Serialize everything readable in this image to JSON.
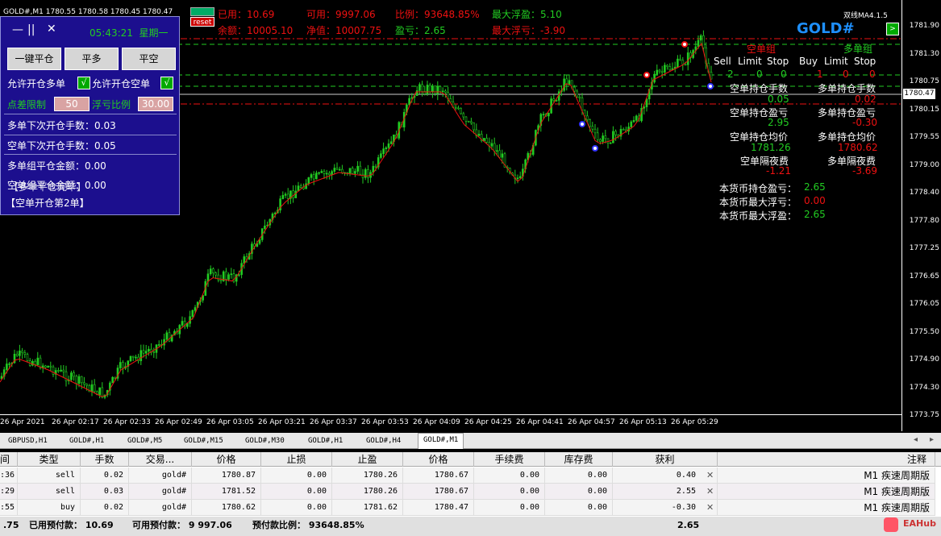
{
  "chart": {
    "title": "GOLD#,M1  1780.55 1780.58 1780.45 1780.47",
    "symbol_big": "GOLD#",
    "ma_label": "双线MA4.1.5",
    "reset_label": "reset",
    "current_price": "1780.47",
    "price_ticks": [
      "1781.90",
      "1781.30",
      "1780.75",
      "1780.15",
      "1779.55",
      "1779.00",
      "1778.40",
      "1777.80",
      "1777.25",
      "1776.65",
      "1776.05",
      "1775.50",
      "1774.90",
      "1774.30",
      "1773.75"
    ],
    "time_ticks": [
      "26 Apr 2021",
      "26 Apr 02:17",
      "26 Apr 02:33",
      "26 Apr 02:49",
      "26 Apr 03:05",
      "26 Apr 03:21",
      "26 Apr 03:37",
      "26 Apr 03:53",
      "26 Apr 04:09",
      "26 Apr 04:25",
      "26 Apr 04:41",
      "26 Apr 04:57",
      "26 Apr 05:13",
      "26 Apr 05:29"
    ]
  },
  "topbar": {
    "used": "已用：10.69",
    "available": "可用：9997.06",
    "ratio": "比例：93648.85%",
    "max_float_profit": "最大浮盈：5.10",
    "balance": "余额：10005.10",
    "equity": "净值：10007.75",
    "profit": "盈亏：2.65",
    "max_float_loss": "最大浮亏：-3.90"
  },
  "panel": {
    "time": "05:43:21",
    "weekday": "星期一",
    "btn_close_all": "一键平仓",
    "btn_close_long": "平多",
    "btn_close_short": "平空",
    "allow_long": "允许开仓多单",
    "allow_short": "允许开仓空单",
    "check": "√",
    "spread_label": "点差限制",
    "spread_value": "50",
    "float_ratio_label": "浮亏比例",
    "float_ratio_value": "30.00",
    "long_next_lots": "多单下次开仓手数：0.03",
    "short_next_lots": "空单下次开仓手数：0.05",
    "long_close_amount": "多单组平仓金额：0.00",
    "short_close_amount": "空单组平仓金额：0.00",
    "overlay_text": "【多单平仓完毕】",
    "status": "【空单开仓第2单】"
  },
  "right_panel": {
    "short_group": "空单组",
    "long_group": "多单组",
    "col_headers": [
      "Sell",
      "Limit",
      "Stop",
      "Buy",
      "Limit",
      "Stop"
    ],
    "counts": [
      "2",
      "0",
      "0",
      "1",
      "0",
      "0"
    ],
    "short_lots_label": "空单持仓手数",
    "short_lots": "0.05",
    "long_lots_label": "多单持仓手数",
    "long_lots": "0.02",
    "short_pl_label": "空单持仓盈亏",
    "short_pl": "2.95",
    "long_pl_label": "多单持仓盈亏",
    "long_pl": "-0.30",
    "short_avg_label": "空单持仓均价",
    "short_avg": "1781.26",
    "long_avg_label": "多单持仓均价",
    "long_avg": "1780.62",
    "short_swap_label": "空单隔夜费",
    "short_swap": "-1.21",
    "long_swap_label": "多单隔夜费",
    "long_swap": "-3.69",
    "cur_pl_label": "本货币持仓盈亏：",
    "cur_pl": "2.65",
    "cur_max_loss_label": "本货币最大浮亏：",
    "cur_max_loss": "0.00",
    "cur_max_profit_label": "本货币最大浮盈：",
    "cur_max_profit": "2.65"
  },
  "tabs": [
    "GBPUSD,H1",
    "GOLD#,H1",
    "GOLD#,M5",
    "GOLD#,M15",
    "GOLD#,M30",
    "GOLD#,H1",
    "GOLD#,H4",
    "GOLD#,M1"
  ],
  "active_tab": "GOLD#,M1",
  "table": {
    "headers": [
      "间",
      "类型",
      "手数",
      "交易...",
      "价格",
      "止损",
      "止盈",
      "价格",
      "手续费",
      "库存费",
      "获利",
      "注释"
    ],
    "rows": [
      [
        ":36",
        "sell",
        "0.02",
        "gold#",
        "1780.87",
        "0.00",
        "1780.26",
        "1780.67",
        "0.00",
        "0.00",
        "0.40",
        "M1 疾速周期版"
      ],
      [
        ":29",
        "sell",
        "0.03",
        "gold#",
        "1781.52",
        "0.00",
        "1780.26",
        "1780.67",
        "0.00",
        "0.00",
        "2.55",
        "M1 疾速周期版"
      ],
      [
        ":55",
        "buy",
        "0.02",
        "gold#",
        "1780.62",
        "0.00",
        "1781.62",
        "1780.47",
        "0.00",
        "0.00",
        "-0.30",
        "M1 疾速周期版"
      ]
    ],
    "footer_left": ".75",
    "footer_used": "已用预付款： 10.69",
    "footer_avail": "可用预付款： 9 997.06",
    "footer_ratio": "预付款比例： 93648.85%",
    "footer_profit": "2.65"
  },
  "watermark": "EAHub"
}
